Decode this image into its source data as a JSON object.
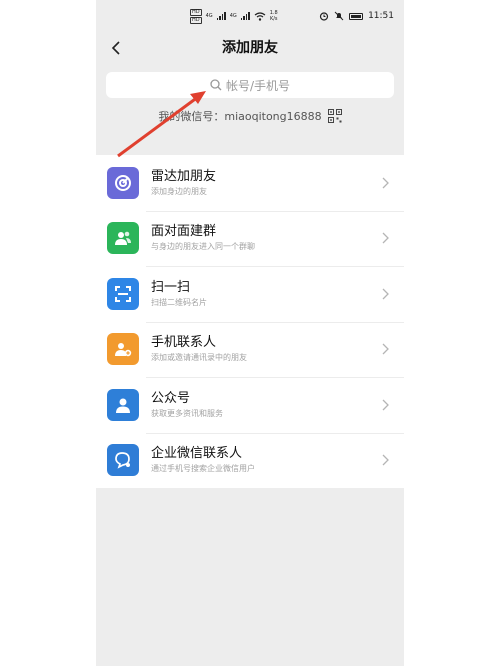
{
  "status": {
    "hd1": "HD",
    "hd2": "HD",
    "net1": "4G",
    "net2": "4G",
    "speed_value": "1.8",
    "speed_unit": "K/s",
    "battery": "",
    "time": "11:51"
  },
  "nav": {
    "title": "添加朋友"
  },
  "search": {
    "placeholder": "帐号/手机号"
  },
  "my_id": {
    "text": "我的微信号：miaoqitong16888"
  },
  "items": [
    {
      "name": "雷达加朋友",
      "sub": "添加身边的朋友",
      "color": "#6a6ad8",
      "icon": "radar-icon"
    },
    {
      "name": "面对面建群",
      "sub": "与身边的朋友进入同一个群聊",
      "color": "#2bb55a",
      "icon": "group-icon"
    },
    {
      "name": "扫一扫",
      "sub": "扫描二维码名片",
      "color": "#2e86e6",
      "icon": "scan-icon"
    },
    {
      "name": "手机联系人",
      "sub": "添加或邀请通讯录中的朋友",
      "color": "#f29a2e",
      "icon": "contact-icon"
    },
    {
      "name": "公众号",
      "sub": "获取更多资讯和服务",
      "color": "#2e7fd8",
      "icon": "person-icon"
    },
    {
      "name": "企业微信联系人",
      "sub": "通过手机号搜索企业微信用户",
      "color": "#2f7dd6",
      "icon": "wecom-icon"
    }
  ],
  "colors": {
    "annotation_arrow": "#e0402f",
    "background": "#ededed"
  }
}
